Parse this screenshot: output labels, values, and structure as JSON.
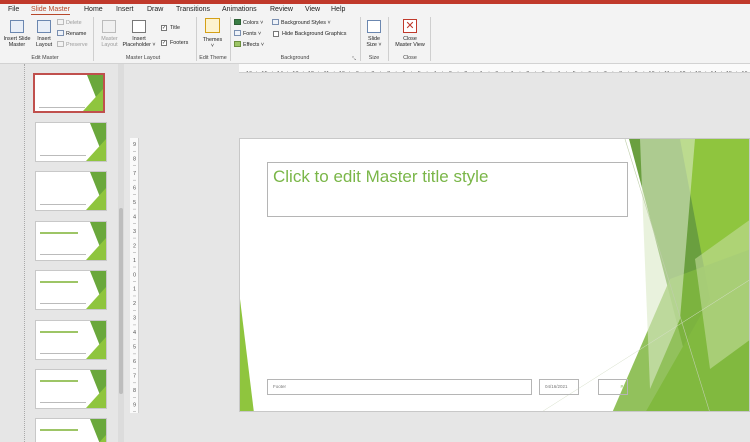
{
  "tabs": [
    {
      "label": "File"
    },
    {
      "label": "Slide Master",
      "active": true
    },
    {
      "label": "Home"
    },
    {
      "label": "Insert"
    },
    {
      "label": "Draw"
    },
    {
      "label": "Transitions"
    },
    {
      "label": "Animations"
    },
    {
      "label": "Review"
    },
    {
      "label": "View"
    },
    {
      "label": "Help"
    }
  ],
  "ribbon": {
    "edit_master": {
      "group_label": "Edit Master",
      "insert_slide_master": [
        "Insert Slide",
        "Master"
      ],
      "insert_layout": [
        "Insert",
        "Layout"
      ],
      "delete": "Delete",
      "rename": "Rename",
      "preserve": "Preserve"
    },
    "master_layout": {
      "group_label": "Master Layout",
      "master_layout_btn": [
        "Master",
        "Layout"
      ],
      "insert_placeholder": [
        "Insert",
        "Placeholder ˅"
      ],
      "title": "Title",
      "footers": "Footers"
    },
    "edit_theme": {
      "group_label": "Edit Theme",
      "themes": "Themes"
    },
    "background": {
      "group_label": "Background",
      "colors": "Colors ˅",
      "fonts": "Fonts ˅",
      "effects": "Effects ˅",
      "background_styles": "Background Styles ˅",
      "hide_background_graphics": "Hide Background Graphics"
    },
    "size": {
      "group_label": "Size",
      "slide_size": [
        "Slide",
        "Size ˅"
      ]
    },
    "close": {
      "group_label": "Close",
      "close_master_view": [
        "Close",
        "Master View"
      ]
    }
  },
  "slide": {
    "title": "Click to edit Master title style",
    "footer": "Footer",
    "date": "04/16/2021",
    "number": "#"
  },
  "ruler": {
    "horizontal_ticks": [
      "16",
      "15",
      "14",
      "13",
      "12",
      "11",
      "10",
      "9",
      "8",
      "7",
      "6",
      "5",
      "4",
      "3",
      "2",
      "1",
      "0",
      "1",
      "2",
      "3",
      "4",
      "5",
      "6",
      "7",
      "8",
      "9",
      "10",
      "11",
      "12",
      "13",
      "14",
      "15",
      "16"
    ],
    "vertical_ticks": [
      "9",
      "8",
      "7",
      "6",
      "5",
      "4",
      "3",
      "2",
      "1",
      "0",
      "1",
      "2",
      "3",
      "4",
      "5",
      "6",
      "7",
      "8",
      "9"
    ]
  },
  "colors": {
    "accent": "#b7472a",
    "green_light": "#8fc53e",
    "green_dark": "#5e9234",
    "title_green": "#7ab648"
  }
}
